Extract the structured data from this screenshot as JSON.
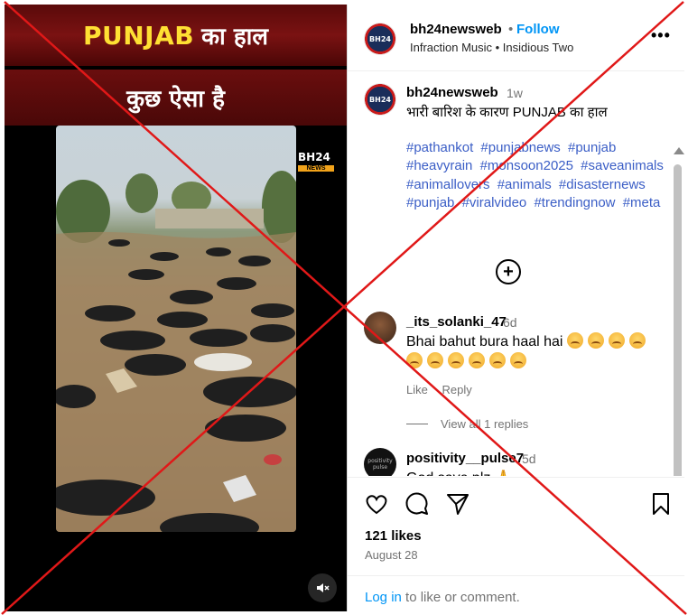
{
  "media": {
    "banner_line1_en": "PUNJAB",
    "banner_line1_hi": "का हाल",
    "banner_line2": "कुछ ऐसा है",
    "watermark_name": "BH24",
    "watermark_tag": "NEWS",
    "mute_icon": "speaker-muted-icon"
  },
  "header": {
    "username": "bh24newsweb",
    "dot": "•",
    "follow_label": "Follow",
    "audio": "Infraction Music • Insidious Two",
    "more_label": "•••",
    "avatar_text": "BH24"
  },
  "caption": {
    "username": "bh24newsweb",
    "time": "1w",
    "text": "भारी बारिश के कारण PUNJAB का हाल",
    "hashtags": [
      "#pathankot",
      "#punjabnews",
      "#punjab",
      "#heavyrain",
      "#monsoon2025",
      "#saveanimals",
      "#animallovers",
      "#animals",
      "#disasternews",
      "#punjab",
      "#viralvideo",
      "#trendingnow",
      "#meta"
    ]
  },
  "more_comments_label": "+",
  "comments": [
    {
      "username": "_its_solanki_47",
      "time": "6d",
      "text": "Bhai bahut bura haal hai",
      "emoji_count": 10,
      "like_label": "Like",
      "reply_label": "Reply",
      "view_replies": "View all 1 replies"
    },
    {
      "username": "positivity__pulse7",
      "time": "5d",
      "text": "God save plz 🙏",
      "avatar_text": "positivity pulse"
    }
  ],
  "actions": {
    "likes": "121 likes",
    "date": "August 28",
    "login_link": "Log in",
    "login_rest": " to like or comment."
  },
  "colors": {
    "accent": "#0095f6",
    "hashtag": "#3b5ec6",
    "cross": "#e01818",
    "banner_yellow": "#ffe033"
  }
}
